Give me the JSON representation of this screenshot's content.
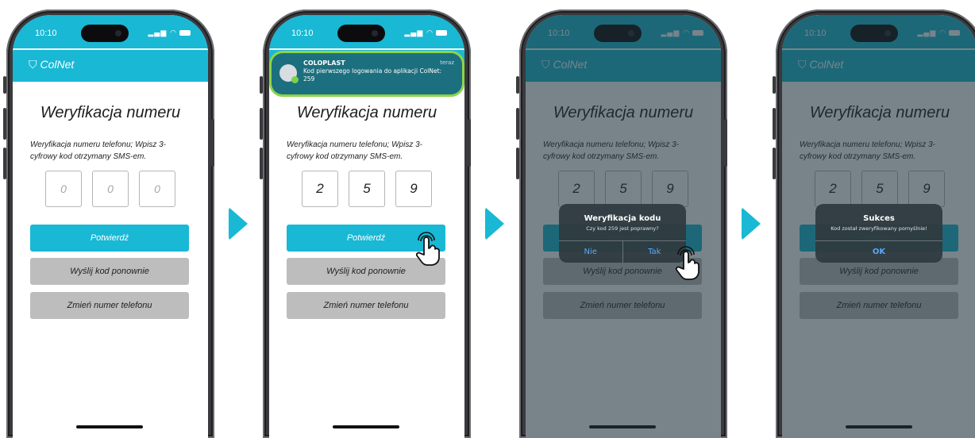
{
  "status_time": "10:10",
  "brand": "ColNet",
  "colors": {
    "accent": "#19b8d5",
    "button_grey": "#bdbdbd",
    "notif_outline": "#8cd44a",
    "arrow": "#19b8d5"
  },
  "screen": {
    "title": "Weryfikacja numeru",
    "description": "Weryfikacja numeru telefonu; Wpisz 3-cyfrowy kod otrzymany SMS-em.",
    "confirm_label": "Potwierdź",
    "resend_label": "Wyślij kod ponownie",
    "change_label": "Zmień numer telefonu"
  },
  "code_placeholder": [
    "0",
    "0",
    "0"
  ],
  "code_values": [
    "2",
    "5",
    "9"
  ],
  "notification": {
    "app": "COLOPLAST",
    "time": "teraz",
    "body": "Kod pierwszego logowania do aplikacji ColNet: 259"
  },
  "confirm_dialog": {
    "title": "Weryfikacja kodu",
    "message": "Czy kod 259 jest poprawny?",
    "no_label": "Nie",
    "yes_label": "Tak"
  },
  "success_dialog": {
    "title": "Sukces",
    "message": "Kod został zweryfikowany pomyślnie!",
    "ok_label": "OK"
  }
}
